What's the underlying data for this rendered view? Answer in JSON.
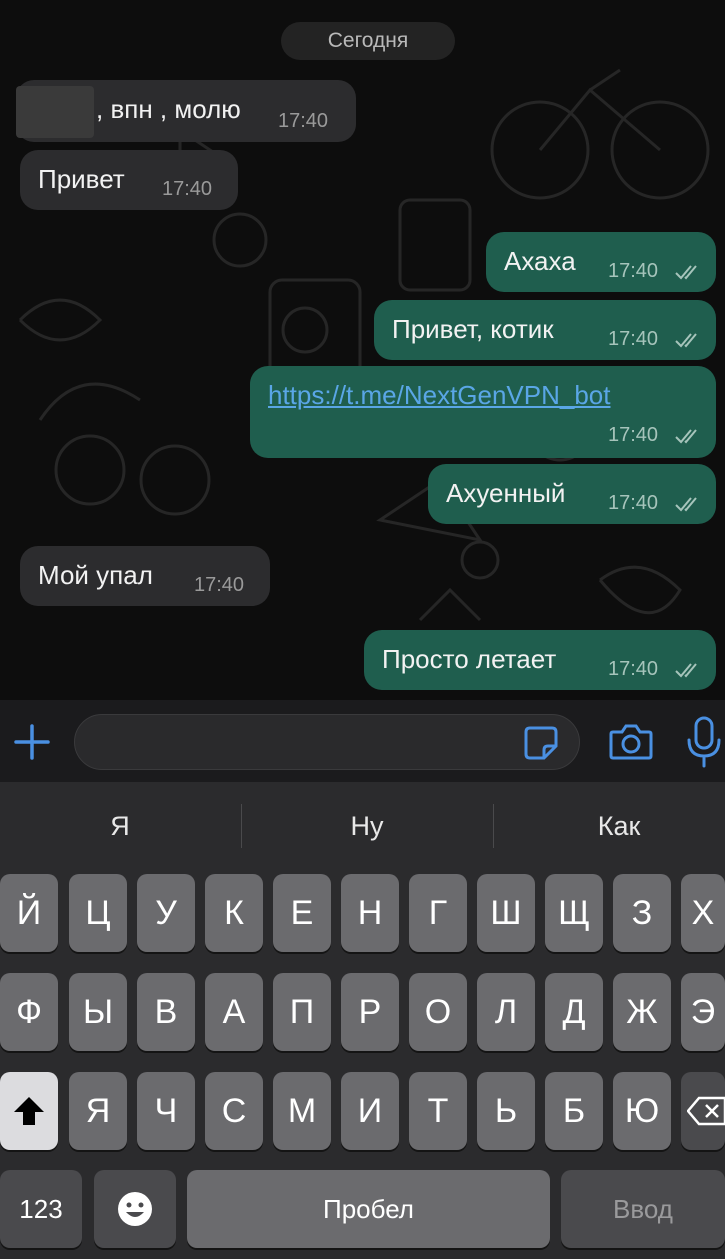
{
  "chat": {
    "date_label": "Сегодня",
    "messages": [
      {
        "dir": "in",
        "text": ", впн , молю",
        "time": "17:40"
      },
      {
        "dir": "in",
        "text": "Привет",
        "time": "17:40"
      },
      {
        "dir": "out",
        "text": "Ахаха",
        "time": "17:40"
      },
      {
        "dir": "out",
        "text": "Привет, котик",
        "time": "17:40"
      },
      {
        "dir": "out",
        "text": "https://t.me/NextGenVPN_bot",
        "time": "17:40",
        "is_link": true
      },
      {
        "dir": "out",
        "text": "Ахуенный",
        "time": "17:40"
      },
      {
        "dir": "in",
        "text": "Мой упал",
        "time": "17:40"
      },
      {
        "dir": "out",
        "text": "Просто летает",
        "time": "17:40"
      }
    ]
  },
  "input_bar": {
    "plus_icon": "plus-icon",
    "sticker_icon": "sticker-icon",
    "camera_icon": "camera-icon",
    "mic_icon": "microphone-icon",
    "accent_color": "#4a90e2"
  },
  "keyboard": {
    "suggestions": [
      "Я",
      "Ну",
      "Как"
    ],
    "row1": [
      "Й",
      "Ц",
      "У",
      "К",
      "Е",
      "Н",
      "Г",
      "Ш",
      "Щ",
      "З",
      "Х"
    ],
    "row2": [
      "Ф",
      "Ы",
      "В",
      "А",
      "П",
      "Р",
      "О",
      "Л",
      "Д",
      "Ж",
      "Э"
    ],
    "row3": [
      "Я",
      "Ч",
      "С",
      "М",
      "И",
      "Т",
      "Ь",
      "Б",
      "Ю"
    ],
    "numbers_label": "123",
    "space_label": "Пробел",
    "return_label": "Ввод",
    "shift_icon": "shift-icon",
    "emoji_icon": "emoji-icon",
    "backspace_icon": "backspace-icon"
  }
}
